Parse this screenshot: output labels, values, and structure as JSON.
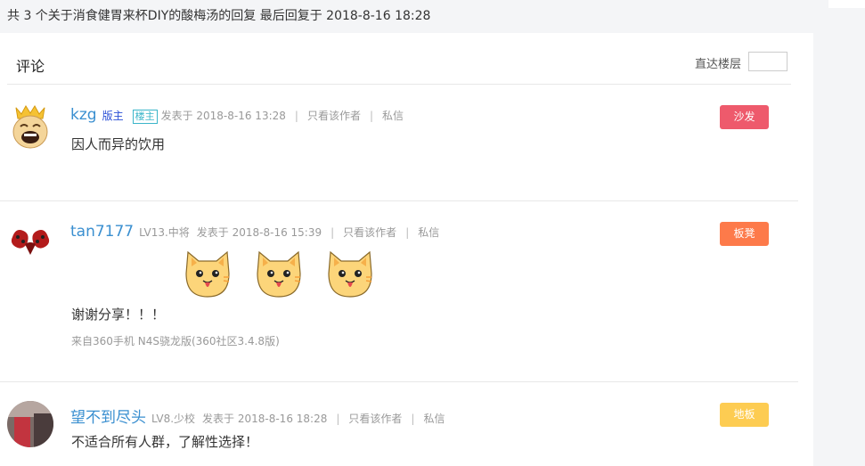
{
  "summary": "共 3 个关于消食健胃来杯DIY的酸梅汤的回复 最后回复于 2018-8-16 18:28",
  "header": {
    "title": "评论",
    "jump_label": "直达楼层"
  },
  "posts": [
    {
      "username": "kzg",
      "role": "版主",
      "badge": "楼主",
      "posted": "发表于 2018-8-16 13:28",
      "author_only": "只看该作者",
      "pm": "私信",
      "floor": "沙发",
      "floor_color": "#ee5a6c",
      "content": "因人而异的饮用"
    },
    {
      "username": "tan7177",
      "level": "LV13.中将",
      "posted": "发表于 2018-8-16 15:39",
      "author_only": "只看该作者",
      "pm": "私信",
      "floor": "板凳",
      "floor_color": "#fd7a4a",
      "content": "谢谢分享！！！",
      "source": "来自360手机 N4S骁龙版(360社区3.4.8版)"
    },
    {
      "username": "望不到尽头",
      "level": "LV8.少校",
      "posted": "发表于 2018-8-16 18:28",
      "author_only": "只看该作者",
      "pm": "私信",
      "floor": "地板",
      "floor_color": "#fdcc52",
      "content": "不适合所有人群，了解性选择！"
    }
  ]
}
